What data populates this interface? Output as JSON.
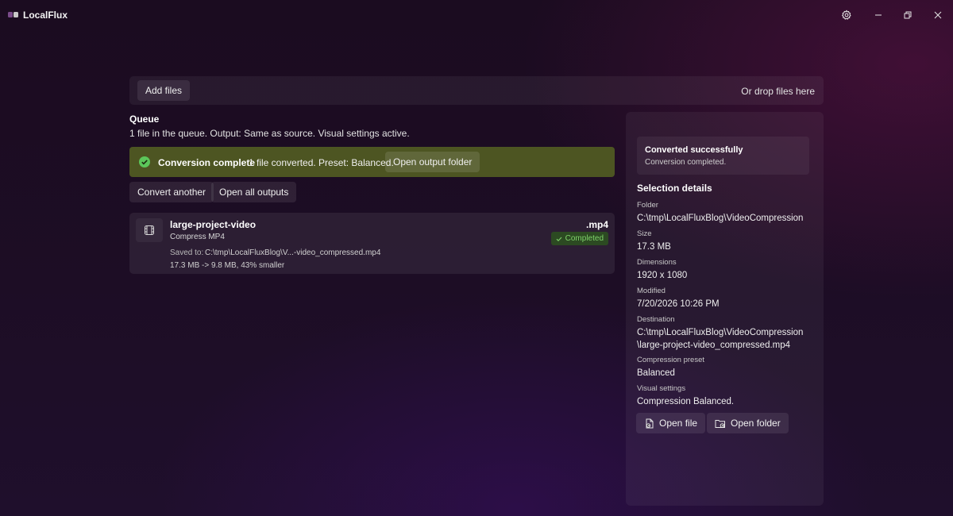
{
  "app": {
    "title": "LocalFlux"
  },
  "titlebar": {
    "icons": [
      "settings-icon",
      "minimize-icon",
      "maximize-icon",
      "close-icon"
    ]
  },
  "dropbar": {
    "add_files": "Add files",
    "hint": "Or drop files here"
  },
  "queue": {
    "title": "Queue",
    "summary": "1 file in the queue. Output: Same as source. Visual settings active."
  },
  "banner": {
    "title": "Conversion complete",
    "message": "1 file converted. Preset: Balanced.",
    "button": "Open output folder",
    "color": "#4d5522"
  },
  "actions": {
    "convert_another": "Convert another",
    "open_all": "Open all outputs"
  },
  "file": {
    "name": "large-project-video",
    "task": "Compress MP4",
    "ext": ".mp4",
    "status": "Completed",
    "saved_label": "Saved to:",
    "saved_path": "C:\\tmp\\LocalFluxBlog\\V...-video_compressed.mp4",
    "size_summary": "17.3 MB -> 9.8 MB, 43% smaller"
  },
  "details": {
    "success_title": "Converted successfully",
    "success_sub": "Conversion completed.",
    "section_title": "Selection details",
    "folder_label": "Folder",
    "folder": "C:\\tmp\\LocalFluxBlog\\VideoCompression",
    "size_label": "Size",
    "size": "17.3 MB",
    "dimensions_label": "Dimensions",
    "dimensions": "1920 x 1080",
    "modified_label": "Modified",
    "modified": "7/20/2026 10:26 PM",
    "destination_label": "Destination",
    "destination_line1": "C:\\tmp\\LocalFluxBlog\\VideoCompression",
    "destination_line2": "\\large-project-video_compressed.mp4",
    "preset_label": "Compression preset",
    "preset": "Balanced",
    "visual_label": "Visual settings",
    "visual": "Compression Balanced.",
    "open_file": "Open file",
    "open_folder": "Open folder"
  }
}
